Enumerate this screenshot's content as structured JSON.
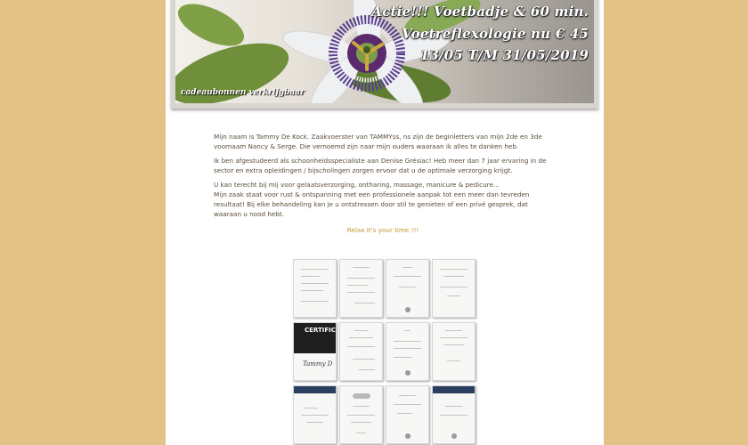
{
  "banner": {
    "line1": "Actie!!! Voetbadje & 60 min.",
    "line2": "Voetreflexologie nu € 45",
    "line3": "13/05 T/M 31/05/2019",
    "tag": "cadeaubonnen verkrijgbaar"
  },
  "content": {
    "p1": "Mijn naam is Tammy De Kock. Zaakvoerster van TAMMYss, ns zijn de beginletters van mijn 2de en 3de voornaam Nancy & Serge. Die vernoemd zijn naar mijn ouders waaraan ik alles te danken heb.",
    "p2": "Ik ben afgestudeerd als schoonheidsspecialiste aan Denise Grésiac! Heb meer dan 7 jaar ervaring in de sector en extra opleidingen / bijscholingen zorgen ervoor dat u de optimale verzorging krijgt.",
    "p3a": "U kan terecht bij mij voor gelaatsverzorging, ontharing, massage, manicure & pedicure...",
    "p3b": "Mijn zaak staat voor rust & ontspanning met een professionele aanpak tot een meer dan tevreden resultaat! Bij elke behandeling kan je u ontstressen door stil te genieten of een privé gesprek, dat waaraan u nood hebt.",
    "relax": "Relax it's your time !!!"
  },
  "certificates": {
    "dark_title": "CERTIFIC",
    "dark_signature": "Tammy D"
  }
}
